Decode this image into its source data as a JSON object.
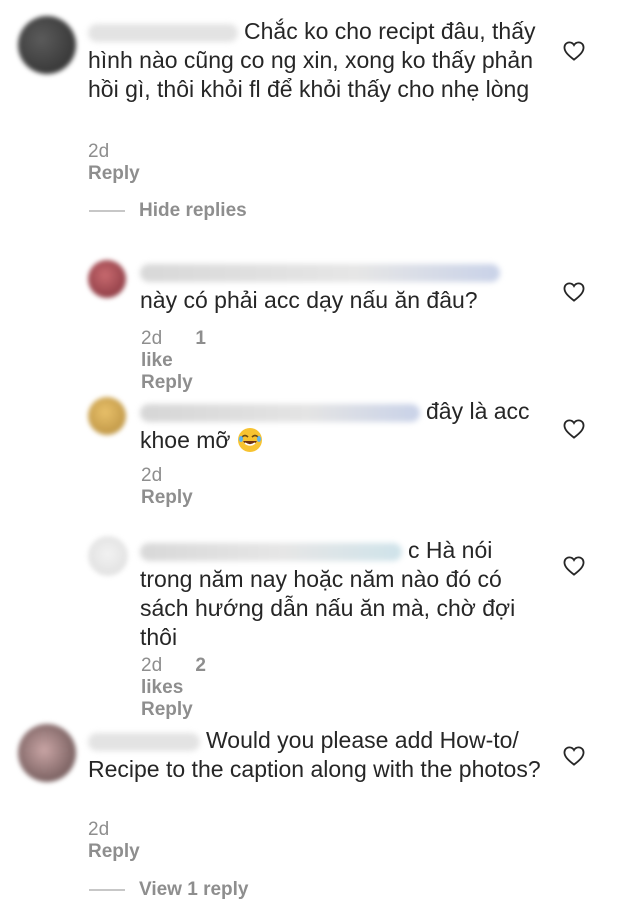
{
  "comments": [
    {
      "text": "Chắc ko cho recipt đâu, thấy hình nào cũng co ng xin, xong ko thấy phản hồi gì, thôi khỏi fl để khỏi thấy cho nhẹ lòng",
      "time": "2d",
      "reply": "Reply"
    },
    {
      "text": "này có phải acc dạy nấu ăn đâu?",
      "time": "2d",
      "likes": "1 like",
      "reply": "Reply"
    },
    {
      "text": "đây là acc khoe mỡ",
      "time": "2d",
      "reply": "Reply"
    },
    {
      "text": "c Hà nói trong năm nay hoặc năm nào đó có sách hướng dẫn nấu ăn mà, chờ đợi thôi",
      "time": "2d",
      "likes": "2 likes",
      "reply": "Reply"
    },
    {
      "text": "Would you please add How-to/ Recipe to the caption along with the photos?",
      "time": "2d",
      "reply": "Reply"
    }
  ],
  "hide_replies": "Hide replies",
  "view_replies": "View 1 reply",
  "colors": {
    "text": "#262626",
    "meta": "#8e8e8e",
    "divider": "#c7c7c7"
  },
  "icons": [
    "heart-icon",
    "face-with-tears-of-joy-emoji"
  ]
}
